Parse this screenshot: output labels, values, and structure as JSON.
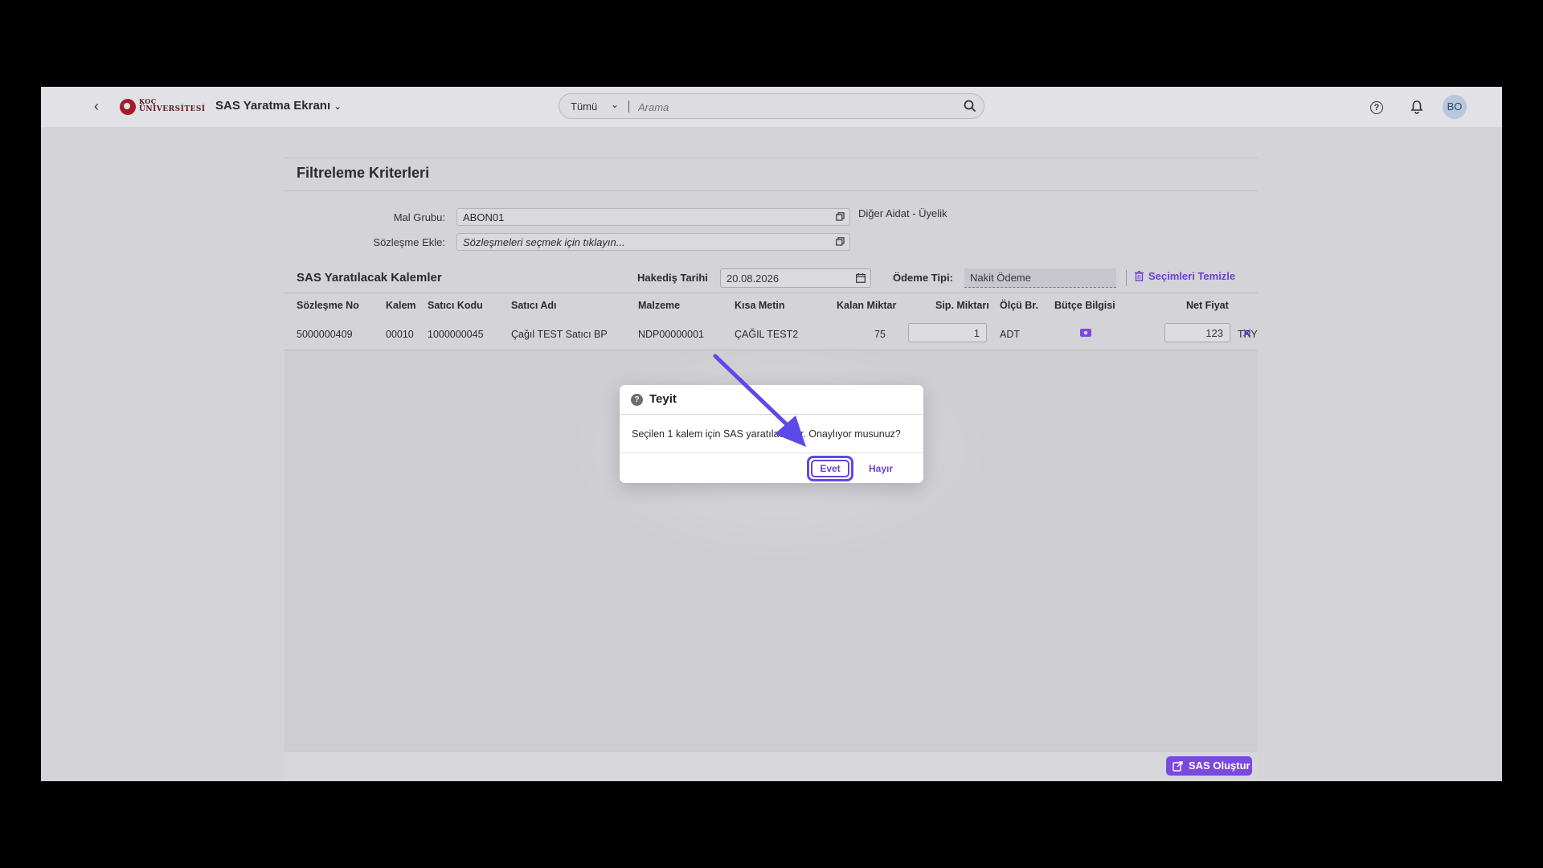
{
  "shell": {
    "logo_line1": "KOÇ",
    "logo_line2": "ÜNİVERSİTESİ",
    "app_title": "SAS Yaratma Ekranı",
    "search_scope": "Tümü",
    "search_placeholder": "Arama",
    "avatar": "BO"
  },
  "filter": {
    "title": "Filtreleme Kriterleri",
    "mal_grubu_label": "Mal Grubu:",
    "mal_grubu_value": "ABON01",
    "mal_grubu_desc": "Diğer Aidat - Üyelik",
    "sozlesme_label": "Sözleşme Ekle:",
    "sozlesme_placeholder": "Sözleşmeleri seçmek için tıklayın..."
  },
  "items": {
    "title": "SAS Yaratılacak Kalemler",
    "hakedis_label": "Hakediş Tarihi",
    "hakedis_value": "20.08.2026",
    "odeme_label": "Ödeme Tipi:",
    "odeme_value": "Nakit Ödeme",
    "clear_label": "Seçimleri Temizle",
    "columns": [
      "Sözleşme No",
      "Kalem",
      "Satıcı Kodu",
      "Satıcı Adı",
      "Malzeme",
      "Kısa Metin",
      "Kalan Miktar",
      "Sip. Miktarı",
      "Ölçü Br.",
      "Bütçe Bilgisi",
      "Net Fiyat"
    ],
    "rows": [
      {
        "sozlesme_no": "5000000409",
        "kalem": "00010",
        "satici_kodu": "1000000045",
        "satici_adi": "Çağıl TEST Satıcı BP",
        "malzeme": "NDP00000001",
        "kisa_metin": "ÇAĞIL TEST2",
        "kalan_miktar": "75",
        "sip_miktari": "1",
        "olcu_br": "ADT",
        "net_fiyat": "123",
        "currency": "TRY"
      }
    ]
  },
  "footer": {
    "create_label": "SAS Oluştur"
  },
  "dialog": {
    "title": "Teyit",
    "message": "Seçilen 1 kalem için SAS yaratılacaktır. Onaylıyor musunuz?",
    "yes": "Evet",
    "no": "Hayır"
  },
  "colors": {
    "accent": "#6d3fd6",
    "annotation_arrow": "#5b4ae8"
  }
}
